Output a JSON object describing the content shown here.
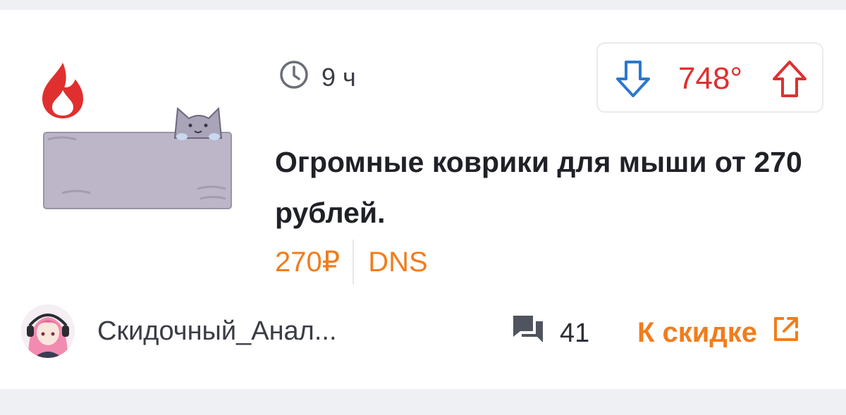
{
  "deal": {
    "time_ago": "9 ч",
    "temperature": "748°",
    "title": "Огромные коврики для мыши от 270 рублей.",
    "price": "270₽",
    "merchant": "DNS",
    "author": "Скидочный_Анал...",
    "comment_count": "41",
    "cta_label": "К скидке"
  },
  "icons": {
    "hot": "flame-icon",
    "time": "clock-icon",
    "vote_down": "arrow-down-icon",
    "vote_up": "arrow-up-icon",
    "comments": "comments-icon",
    "external": "external-link-icon"
  },
  "colors": {
    "hot_red": "#e02f2f",
    "vote_blue": "#2b77d0",
    "accent_orange": "#f07d1e",
    "text_dark": "#1f2127"
  }
}
